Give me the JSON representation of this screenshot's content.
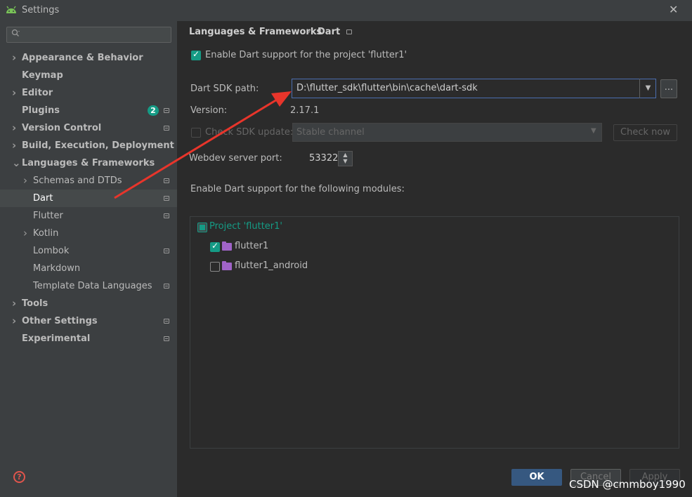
{
  "window": {
    "title": "Settings",
    "close_glyph": "✕",
    "app_icon": "android-icon"
  },
  "sidebar": {
    "search_placeholder": "",
    "items": [
      {
        "label": "Appearance & Behavior",
        "bold": true,
        "expandable": true,
        "level": 0
      },
      {
        "label": "Keymap",
        "bold": true,
        "expandable": false,
        "level": 0
      },
      {
        "label": "Editor",
        "bold": true,
        "expandable": true,
        "level": 0
      },
      {
        "label": "Plugins",
        "bold": true,
        "expandable": false,
        "level": 0,
        "badge": "2",
        "gear": true
      },
      {
        "label": "Version Control",
        "bold": true,
        "expandable": true,
        "level": 0,
        "gear": true
      },
      {
        "label": "Build, Execution, Deployment",
        "bold": true,
        "expandable": true,
        "level": 0
      },
      {
        "label": "Languages & Frameworks",
        "bold": true,
        "expandable": true,
        "expanded": true,
        "level": 0
      },
      {
        "label": "Schemas and DTDs",
        "bold": false,
        "expandable": true,
        "level": 1,
        "gear": true
      },
      {
        "label": "Dart",
        "bold": false,
        "expandable": false,
        "level": 1,
        "gear": true,
        "selected": true
      },
      {
        "label": "Flutter",
        "bold": false,
        "expandable": false,
        "level": 1,
        "gear": true
      },
      {
        "label": "Kotlin",
        "bold": false,
        "expandable": true,
        "level": 1
      },
      {
        "label": "Lombok",
        "bold": false,
        "expandable": false,
        "level": 1,
        "gear": true
      },
      {
        "label": "Markdown",
        "bold": false,
        "expandable": false,
        "level": 1
      },
      {
        "label": "Template Data Languages",
        "bold": false,
        "expandable": false,
        "level": 1,
        "gear": true
      },
      {
        "label": "Tools",
        "bold": true,
        "expandable": true,
        "level": 0
      },
      {
        "label": "Other Settings",
        "bold": true,
        "expandable": true,
        "level": 0,
        "gear": true
      },
      {
        "label": "Experimental",
        "bold": true,
        "expandable": false,
        "level": 0,
        "gear": true
      }
    ]
  },
  "breadcrumb": {
    "parent": "Languages & Frameworks",
    "separator": "›",
    "current": "Dart"
  },
  "main": {
    "enable_label": "Enable Dart support for the project 'flutter1'",
    "enable_checked": true,
    "sdk_path_label": "Dart SDK path:",
    "sdk_path_value": "D:\\flutter_sdk\\flutter\\bin\\cache\\dart-sdk",
    "browse_label": "...",
    "version_label": "Version:",
    "version_value": "2.17.1",
    "check_update_label": "Check SDK update:",
    "channel_value": "Stable channel",
    "check_now_label": "Check now",
    "webdev_label": "Webdev server port:",
    "webdev_value": "53322",
    "modules_label": "Enable Dart support for the following modules:",
    "modules": [
      {
        "label": "Project 'flutter1'",
        "state": "partial",
        "level": 0
      },
      {
        "label": "flutter1",
        "state": "checked",
        "level": 1
      },
      {
        "label": "flutter1_android",
        "state": "unchecked",
        "level": 1
      }
    ]
  },
  "footer": {
    "ok_label": "OK",
    "cancel_label": "Cancel",
    "apply_label": "Apply",
    "help_glyph": "?"
  },
  "watermark": "CSDN @cmmboy1990",
  "colors": {
    "accent": "#159b85",
    "selection": "#4b6eaf",
    "arrow": "#e8352b"
  }
}
